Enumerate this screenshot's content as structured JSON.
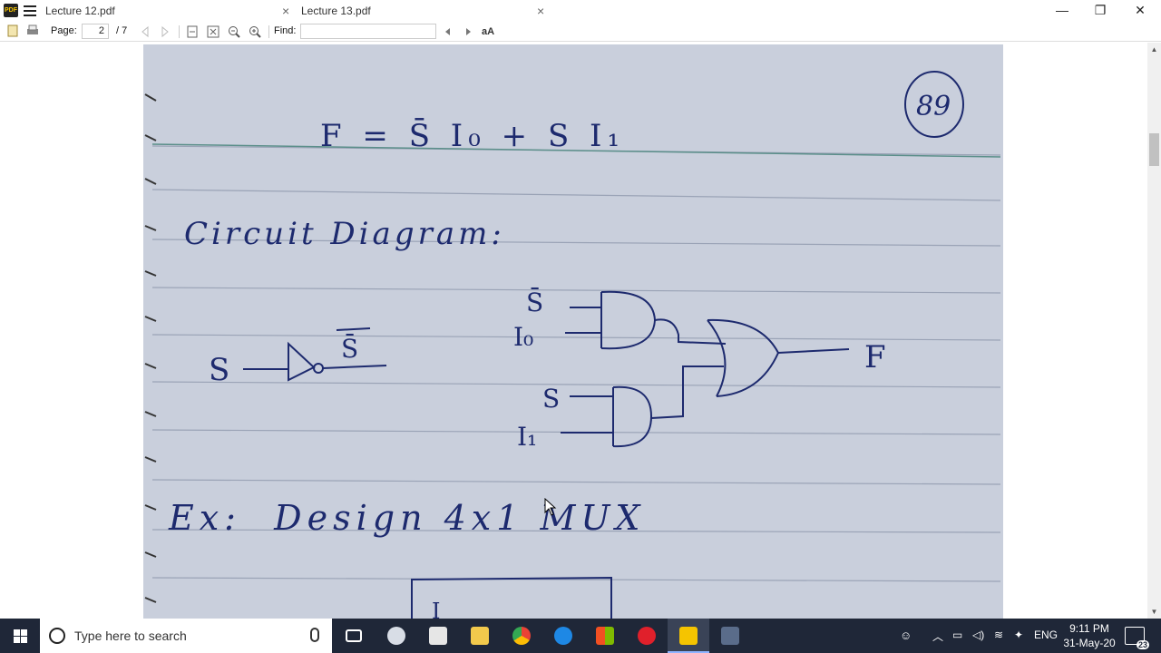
{
  "tabs": [
    {
      "label": "Lecture 12.pdf",
      "close": "×"
    },
    {
      "label": "Lecture 13.pdf",
      "close": "×"
    }
  ],
  "window_controls": {
    "minimize": "—",
    "maximize": "❐",
    "close": "✕"
  },
  "toolbar": {
    "page_label": "Page:",
    "page_value": "2",
    "page_total": "/ 7",
    "find_label": "Find:"
  },
  "page_content": {
    "page_number": "89",
    "equation": "F = S̄ I₀ + S I₁",
    "heading": "Circuit Diagram:",
    "not_gate": {
      "input": "S",
      "output": "S̄"
    },
    "and_gate_1": {
      "inputs": [
        "S̄",
        "I₀"
      ]
    },
    "and_gate_2": {
      "inputs": [
        "S",
        "I₁"
      ]
    },
    "or_output": "F",
    "exercise": "Ex:  Design 4x1 MUX",
    "box_label": "I"
  },
  "taskbar": {
    "search_placeholder": "Type here to search",
    "language": "ENG",
    "time": "9:11 PM",
    "date": "31-May-20",
    "notification_count": "23"
  },
  "colors": {
    "taskbar_bg": "#1f2738",
    "page_bg": "#c9cfdc",
    "ink": "#1d2a6e",
    "rule": "#9aa3b6"
  }
}
